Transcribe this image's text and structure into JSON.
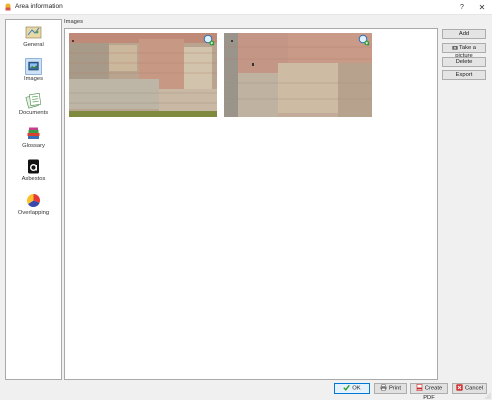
{
  "window": {
    "title": "Area information",
    "help_glyph": "?",
    "close_glyph": "✕",
    "icon": "app-icon"
  },
  "nav": {
    "items": [
      {
        "label": "General",
        "icon": "map-icon"
      },
      {
        "label": "Images",
        "icon": "image-icon",
        "active": true
      },
      {
        "label": "Documents",
        "icon": "documents-icon"
      },
      {
        "label": "Glossary",
        "icon": "books-icon"
      },
      {
        "label": "Asbestos",
        "icon": "asbestos-icon"
      },
      {
        "label": "Overlapping",
        "icon": "pie-chart-icon"
      }
    ]
  },
  "images": {
    "group_label": "Images",
    "thumbnails": [
      {
        "name": "image-thumbnail-1",
        "icon": "zoom-add-icon"
      },
      {
        "name": "image-thumbnail-2",
        "icon": "zoom-add-icon"
      }
    ]
  },
  "side_buttons": {
    "add": "Add",
    "take_picture": "Take a picture",
    "delete": "Delete",
    "export": "Export"
  },
  "footer": {
    "ok": "OK",
    "print": "Print",
    "create_pdf": "Create PDF",
    "cancel": "Cancel"
  },
  "colors": {
    "accent": "#0078d7",
    "ok_check": "#2e9e2e",
    "cancel_x": "#d32f2f"
  }
}
